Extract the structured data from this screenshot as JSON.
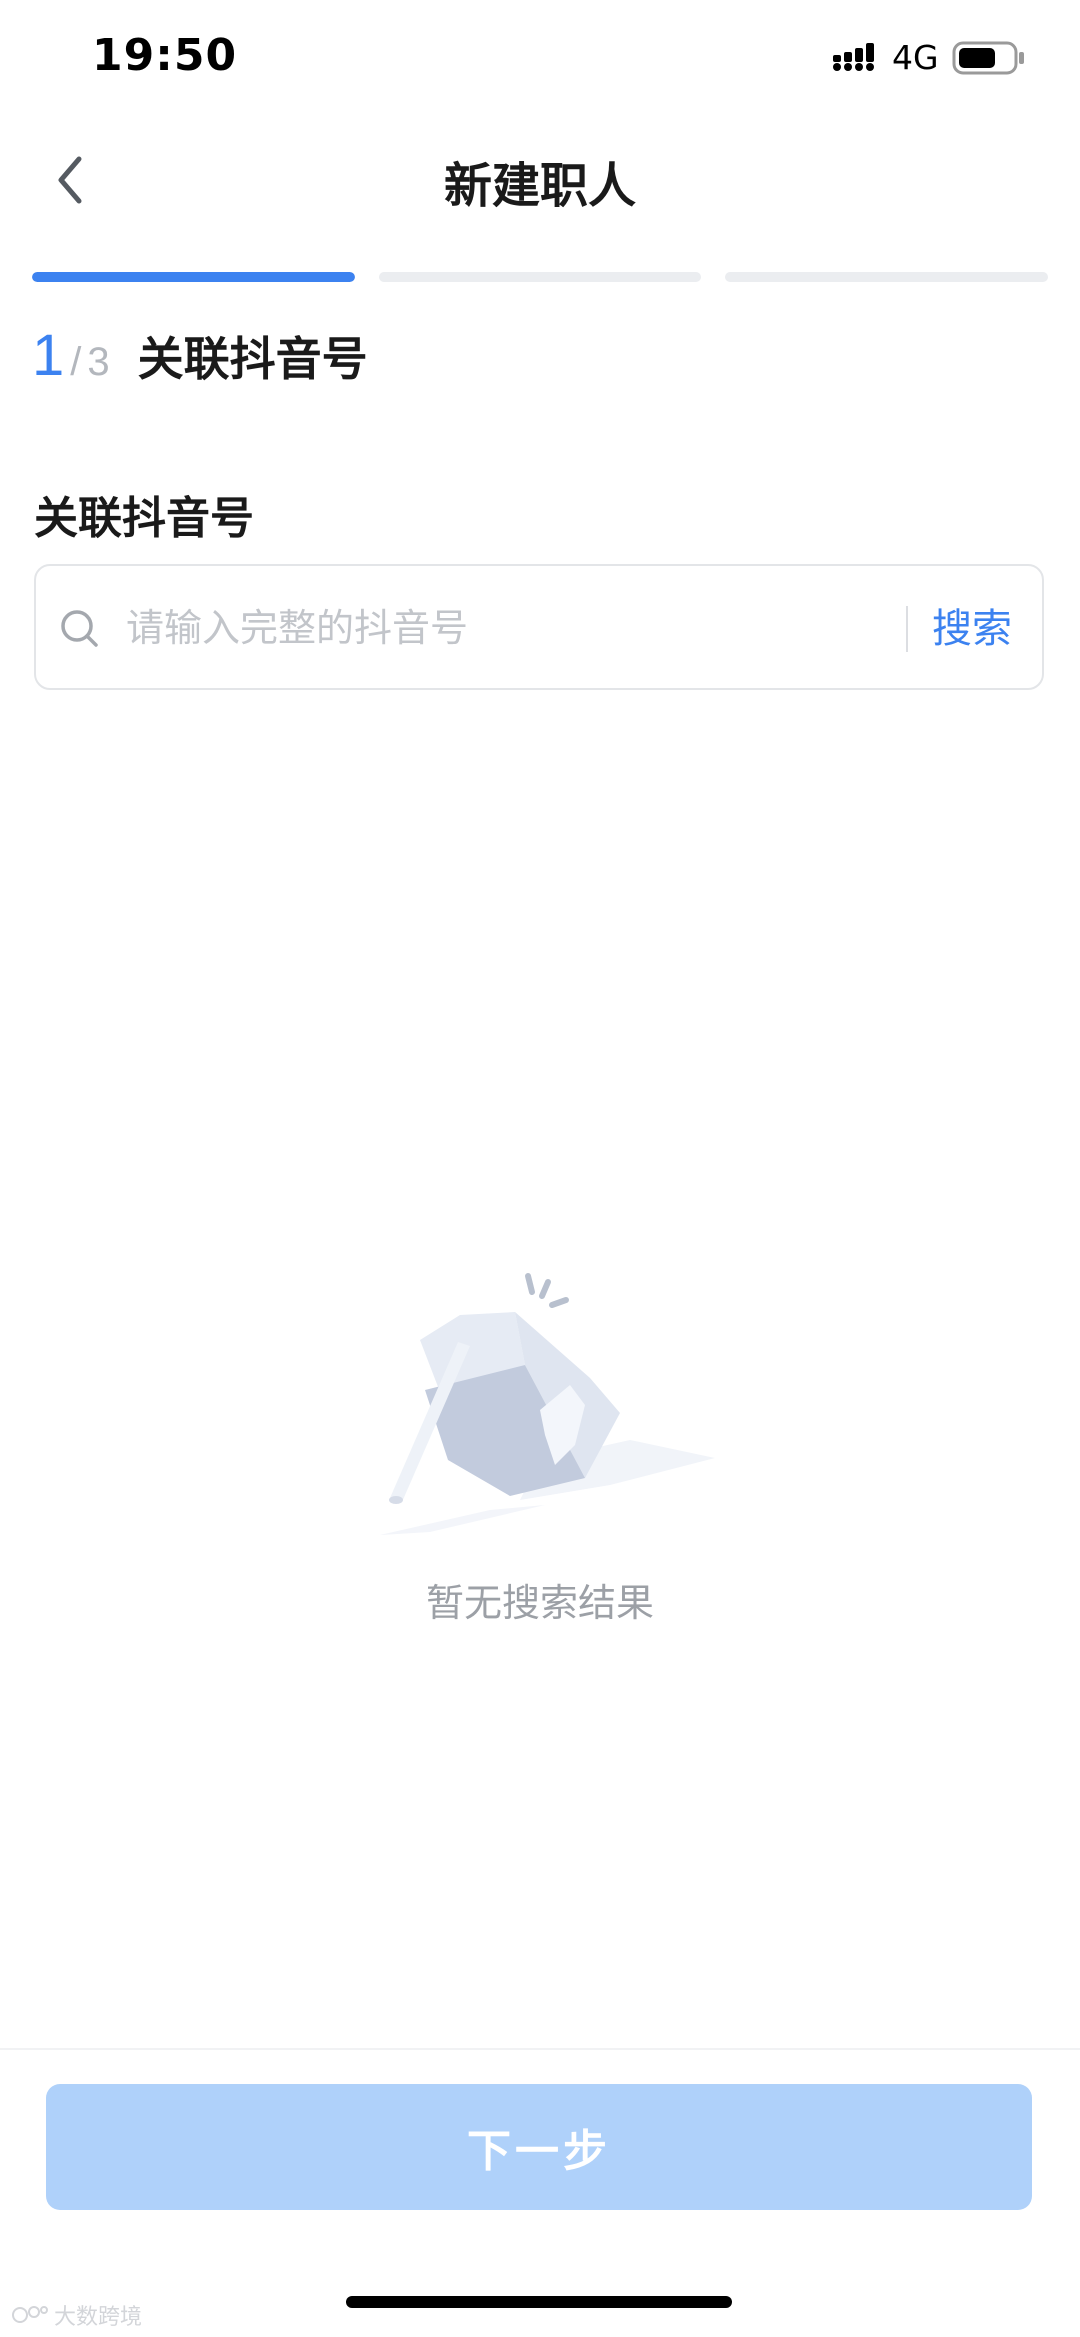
{
  "status_bar": {
    "time": "19:50",
    "network": "4G",
    "icons": [
      "signal-icon",
      "battery-icon"
    ]
  },
  "nav": {
    "title": "新建职人",
    "back_icon": "chevron-left-icon"
  },
  "progress": {
    "segments": 3,
    "current": 1
  },
  "step": {
    "current": "1",
    "separator": "/",
    "total": "3",
    "title": "关联抖音号"
  },
  "form": {
    "field_label": "关联抖音号",
    "search": {
      "placeholder": "请输入完整的抖音号",
      "value": "",
      "button_label": "搜索",
      "icon": "search-icon"
    }
  },
  "empty_state": {
    "text": "暂无搜索结果",
    "illustration": "empty-box-illustration"
  },
  "footer": {
    "next_label": "下一步"
  },
  "watermark": {
    "text": "大数跨境"
  },
  "colors": {
    "accent": "#3c82f0",
    "button_disabled": "#afd1fa",
    "track": "#ebedf0",
    "placeholder": "#c2c5ca",
    "muted_text": "#9ca0a6"
  }
}
